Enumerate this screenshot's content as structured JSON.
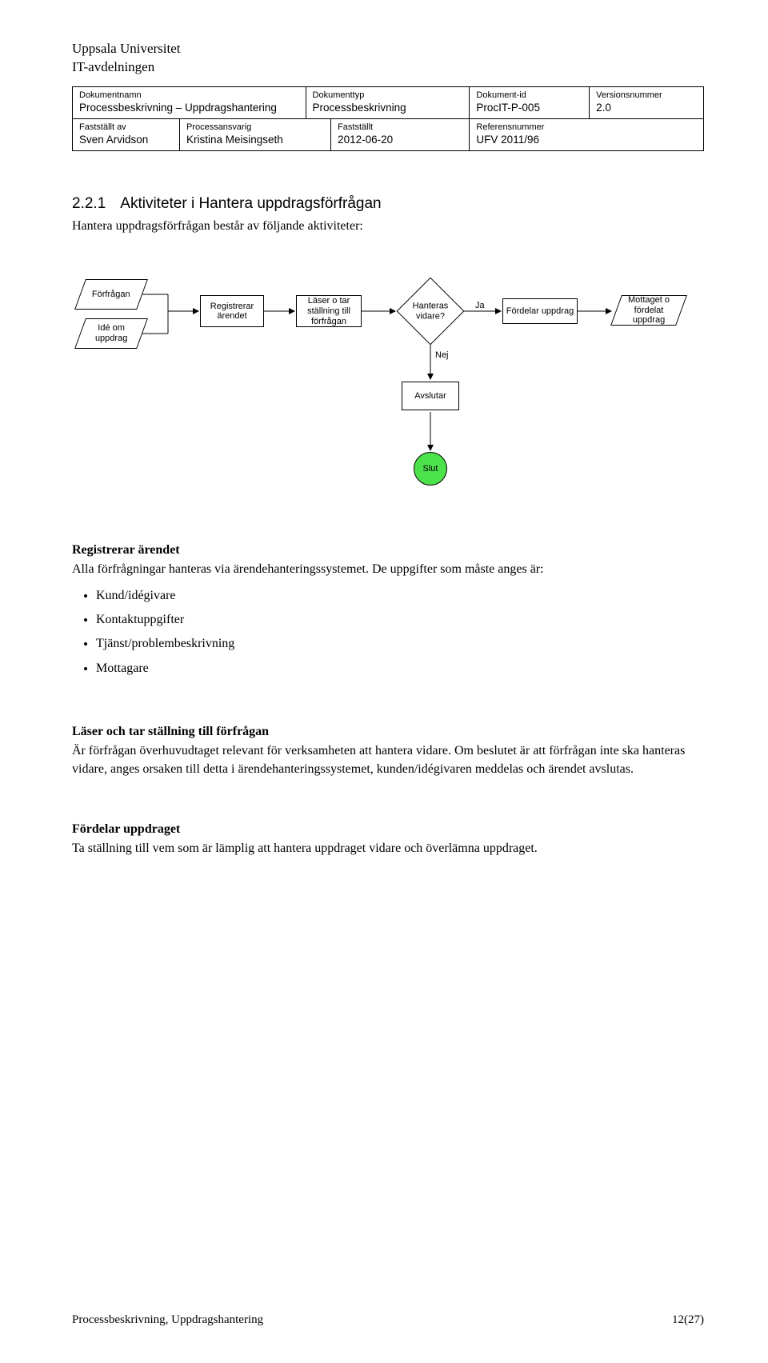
{
  "uni": {
    "name": "Uppsala Universitet",
    "dept": "IT-avdelningen"
  },
  "meta": {
    "row1": [
      {
        "label": "Dokumentnamn",
        "value": "Processbeskrivning – Uppdragshantering"
      },
      {
        "label": "Dokumenttyp",
        "value": "Processbeskrivning"
      },
      {
        "label": "Dokument-id",
        "value": "ProcIT-P-005"
      },
      {
        "label": "Versionsnummer",
        "value": "2.0"
      }
    ],
    "row2": [
      {
        "label": "Fastställt av",
        "value": "Sven Arvidson"
      },
      {
        "label": "Processansvarig",
        "value": "Kristina Meisingseth"
      },
      {
        "label": "Fastställt",
        "value": "2012-06-20"
      },
      {
        "label": "Referensnummer",
        "value": "UFV 2011/96"
      }
    ]
  },
  "section": {
    "number": "2.2.1",
    "title": "Aktiviteter i Hantera uppdragsförfrågan",
    "lead": "Hantera uppdragsförfrågan består av följande aktiviteter:"
  },
  "flow": {
    "p1": "Förfrågan",
    "p2": "Idé om uppdrag",
    "r1": "Registrerar ärendet",
    "r2": "Läser o tar ställning till förfrågan",
    "d1": "Hanteras vidare?",
    "r3": "Fördelar uppdrag",
    "p3": "Mottaget o fördelat uppdrag",
    "r4": "Avslutar",
    "end": "Slut",
    "yes": "Ja",
    "no": "Nej"
  },
  "body": {
    "h1": "Registrerar ärendet",
    "p1": "Alla förfrågningar hanteras via ärendehanteringssystemet. De uppgifter som måste anges är:",
    "bullets": [
      "Kund/idégivare",
      "Kontaktuppgifter",
      "Tjänst/problembeskrivning",
      "Mottagare"
    ],
    "h2": "Läser och tar ställning till förfrågan",
    "p2": "Är förfrågan överhuvudtaget relevant för verksamheten att hantera vidare. Om beslutet är att förfrågan inte ska hanteras vidare, anges orsaken till detta i ärendehanteringssystemet, kunden/idégivaren meddelas och ärendet avslutas.",
    "h3": "Fördelar uppdraget",
    "p3": "Ta ställning till vem som är lämplig att hantera uppdraget vidare och överlämna uppdraget."
  },
  "footer": {
    "left": "Processbeskrivning, Uppdragshantering",
    "right": "12(27)"
  }
}
